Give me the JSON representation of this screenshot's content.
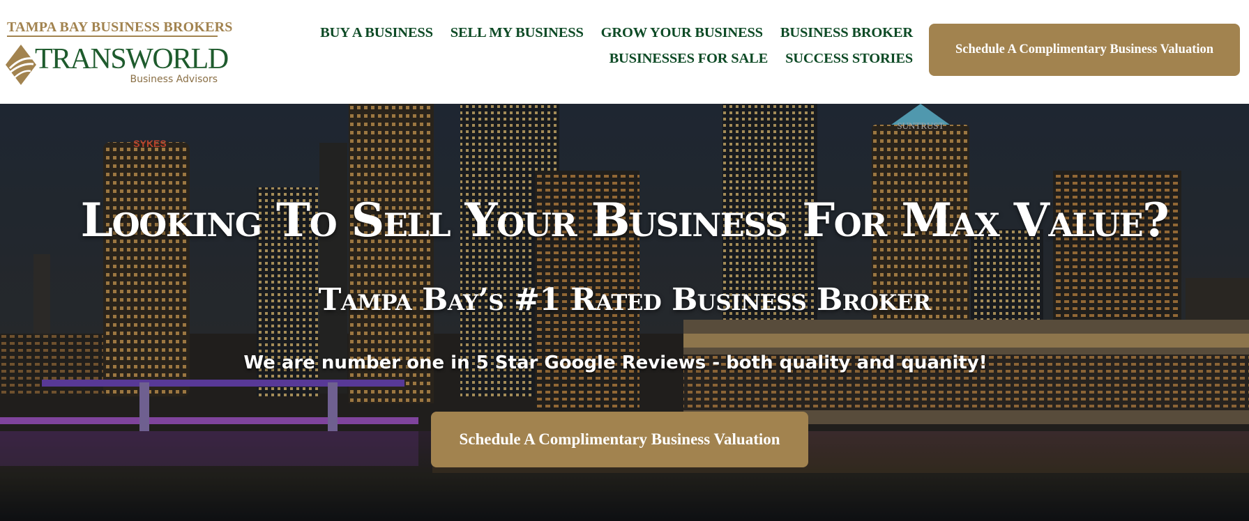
{
  "header": {
    "logo": {
      "kicker": "TAMPA BAY BUSINESS BROKERS",
      "wordmark": "TRANSWORLD",
      "subtitle": "Business Advisors",
      "icon": "diamond-logo-icon"
    },
    "nav": {
      "row1": [
        "BUY A BUSINESS",
        "SELL MY BUSINESS",
        "GROW YOUR BUSINESS",
        "BUSINESS BROKER"
      ],
      "row2": [
        "BUSINESSES FOR SALE",
        "SUCCESS STORIES"
      ]
    },
    "cta_label": "Schedule A Complimentary Business Valuation"
  },
  "hero": {
    "skyline_signs": [
      "SYKES",
      "SUNTRUST"
    ],
    "title": "Looking To Sell Your Business For Max Value?",
    "subtitle": "Tampa Bay’s #1 Rated Business Broker",
    "tagline": "We are number one in 5 Star Google Reviews - both quality and quanity!",
    "cta_label": "Schedule A Complimentary Business Valuation"
  },
  "colors": {
    "brand_green": "#0d4a25",
    "brand_gold": "#a2834f",
    "white": "#ffffff"
  }
}
